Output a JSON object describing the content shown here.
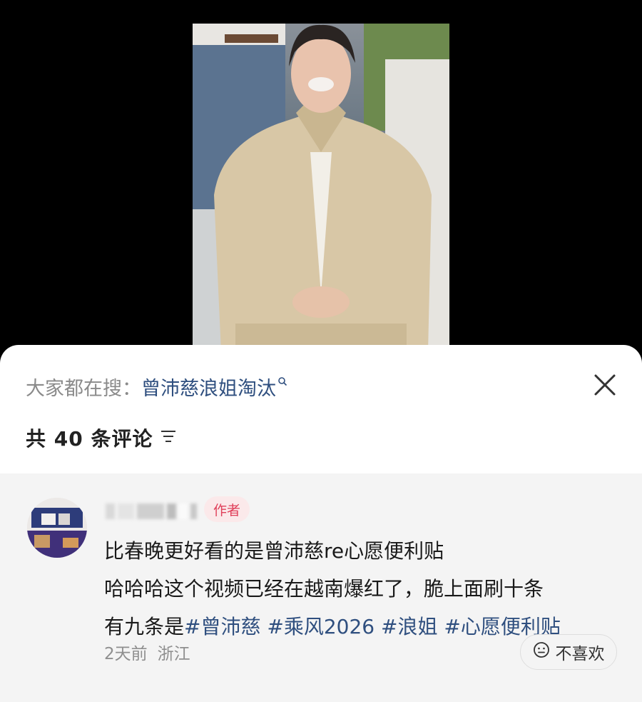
{
  "search": {
    "prefix": "大家都在搜：",
    "query": "曾沛慈浪姐淘汰"
  },
  "comments_header": {
    "count_text": "共 40 条评论"
  },
  "comment": {
    "author_badge": "作者",
    "body_prefix": "比春晚更好看的是曾沛慈re心愿便利贴\n哈哈哈这个视频已经在越南爆红了，脆上面刷十条\n有九条是",
    "hashtags": [
      "#曾沛慈",
      "#乘风2026",
      "#浪姐",
      "#心愿便利贴"
    ],
    "time": "2天前",
    "location": "浙江",
    "dislike_label": "不喜欢"
  },
  "icons": {
    "close": "close-icon",
    "sort": "sort-icon",
    "search": "search-icon",
    "dislike": "neutral-face-icon"
  },
  "colors": {
    "link": "#2f4f7f",
    "badge_text": "#e0405a",
    "badge_bg": "#fbe9ea",
    "comment_bg": "#f4f4f4"
  }
}
